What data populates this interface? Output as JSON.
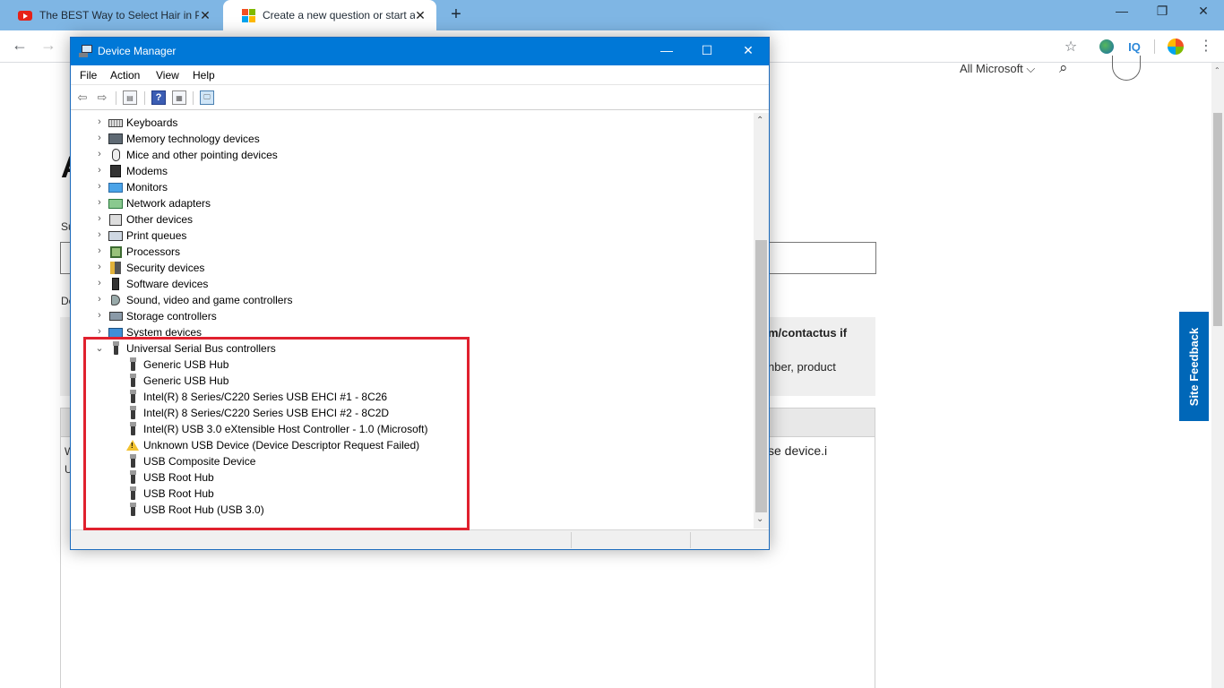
{
  "browser": {
    "tabs": [
      {
        "title": "The BEST Way to Select Hair in Photoshop",
        "favicon": "youtube-icon",
        "active": false
      },
      {
        "title": "Create a new question or start a discussion",
        "favicon": "microsoft-icon",
        "active": true
      }
    ],
    "tab_close_glyph": "✕",
    "new_tab_glyph": "+",
    "window_controls": {
      "minimize": "—",
      "restore": "❐",
      "close": "✕"
    },
    "nav": {
      "back": "←",
      "forward": "→"
    },
    "toolbar_icons": {
      "star": "☆",
      "extension_iq": "IQ",
      "menu": "⋮"
    }
  },
  "webpage": {
    "header_link": "All Microsoft",
    "header_chevron": "⌵",
    "search_glyph": "⌕",
    "heading_fragment": "A",
    "subject_label_fragment": "Su",
    "details_label_fragment": "De",
    "note_line1": "m/contactus if",
    "note_line2": "nber, product",
    "editor_line1_fragment": "W",
    "editor_line2_fragment": "U",
    "editor_text_fragment": "se device.i",
    "site_feedback": "Site Feedback"
  },
  "device_manager": {
    "title": "Device Manager",
    "window_controls": {
      "minimize": "—",
      "maximize": "☐",
      "close": "✕"
    },
    "menu": [
      "File",
      "Action",
      "View",
      "Help"
    ],
    "toolbar": {
      "back": "⇦",
      "forward": "⇨",
      "properties": "▤",
      "help": "?",
      "view": "▦",
      "scan": "🖵"
    },
    "tree": {
      "collapsed_glyph": "›",
      "expanded_glyph": "⌄",
      "categories": [
        {
          "label": "Keyboards",
          "icon": "keyboard-icon"
        },
        {
          "label": "Memory technology devices",
          "icon": "memory-icon"
        },
        {
          "label": "Mice and other pointing devices",
          "icon": "mouse-icon"
        },
        {
          "label": "Modems",
          "icon": "modem-icon"
        },
        {
          "label": "Monitors",
          "icon": "monitor-icon"
        },
        {
          "label": "Network adapters",
          "icon": "network-adapter-icon"
        },
        {
          "label": "Other devices",
          "icon": "other-device-icon"
        },
        {
          "label": "Print queues",
          "icon": "printer-icon"
        },
        {
          "label": "Processors",
          "icon": "processor-icon"
        },
        {
          "label": "Security devices",
          "icon": "security-device-icon"
        },
        {
          "label": "Software devices",
          "icon": "software-device-icon"
        },
        {
          "label": "Sound, video and game controllers",
          "icon": "sound-icon"
        },
        {
          "label": "Storage controllers",
          "icon": "storage-icon"
        },
        {
          "label": "System devices",
          "icon": "system-device-icon"
        }
      ],
      "expanded_category": {
        "label": "Universal Serial Bus controllers",
        "icon": "usb-icon",
        "children": [
          {
            "label": "Generic USB Hub",
            "icon": "usb-icon"
          },
          {
            "label": "Generic USB Hub",
            "icon": "usb-icon"
          },
          {
            "label": "Intel(R) 8 Series/C220 Series USB EHCI #1 - 8C26",
            "icon": "usb-icon"
          },
          {
            "label": "Intel(R) 8 Series/C220 Series USB EHCI #2 - 8C2D",
            "icon": "usb-icon"
          },
          {
            "label": "Intel(R) USB 3.0 eXtensible Host Controller - 1.0 (Microsoft)",
            "icon": "usb-icon"
          },
          {
            "label": "Unknown USB Device (Device Descriptor Request Failed)",
            "icon": "usb-warning-icon"
          },
          {
            "label": "USB Composite Device",
            "icon": "usb-icon"
          },
          {
            "label": "USB Root Hub",
            "icon": "usb-icon"
          },
          {
            "label": "USB Root Hub",
            "icon": "usb-icon"
          },
          {
            "label": "USB Root Hub (USB 3.0)",
            "icon": "usb-icon"
          }
        ]
      }
    },
    "scroll_glyphs": {
      "up": "⌃",
      "down": "⌄"
    }
  },
  "colors": {
    "titlebar": "#0078d7",
    "tabbar": "#7fb6e4",
    "highlight": "#e0212e",
    "site_feedback": "#0067b8"
  }
}
